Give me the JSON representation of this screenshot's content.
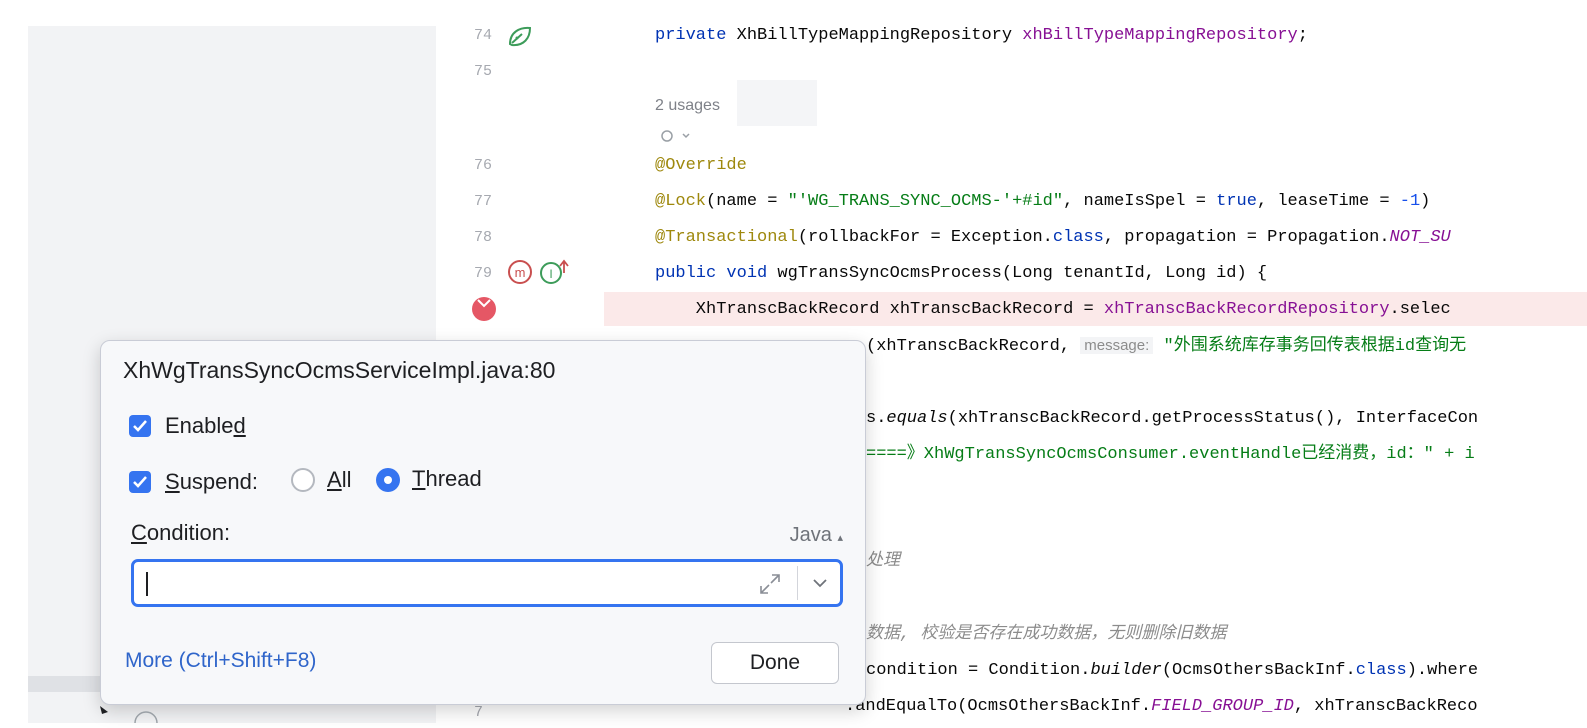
{
  "editor": {
    "usages_hint": "2 usages",
    "line_numbers": [
      "74",
      "75",
      "76",
      "77",
      "78",
      "79",
      "7"
    ],
    "lines": {
      "l74": {
        "kw": "private ",
        "type": "XhBillTypeMappingRepository ",
        "field": "xhBillTypeMappingRepository",
        "end": ";"
      },
      "l76": {
        "ann": "@Override"
      },
      "l77": {
        "ann": "@Lock",
        "a": "(name = ",
        "str": "\"'WG_TRANS_SYNC_OCMS-'+#id\"",
        "b": ", nameIsSpel = ",
        "kw": "true",
        "c": ", leaseTime = ",
        "num": "-1",
        "d": ")"
      },
      "l78": {
        "ann": "@Transactional",
        "a": "(rollbackFor = Exception.",
        "kw": "class",
        "b": ", propagation = Propagation.",
        "const": "NOT_SU"
      },
      "l79": {
        "kw": "public void ",
        "name": "wgTransSyncOcmsProcess",
        "a": "(Long tenantId, Long id) {"
      },
      "l80": {
        "a": "    XhTranscBackRecord xhTranscBackRecord = ",
        "field": "xhTranscBackRecordRepository",
        "b": ".selec"
      },
      "l81": {
        "a": "(xhTranscBackRecord, ",
        "hint": "message:",
        "str": "\"外围系统库存事务回传表根据id查询无"
      },
      "l82": {
        "a": "s.",
        "ital": "equals",
        "b": "(xhTranscBackRecord.getProcessStatus(), InterfaceCon"
      },
      "l83": {
        "str": "====》XhWgTransSyncOcmsConsumer.eventHandle已经消费，id：\" + i"
      },
      "l84": {
        "cmt": "处理"
      },
      "l85": {
        "cmt": "数据, 校验是否存在成功数据，无则删除旧数据"
      },
      "l86": {
        "a": "condition = Condition.",
        "ital": "builder",
        "b": "(OcmsOthersBackInf.",
        "kw": "class",
        "c": ").where"
      },
      "l87": {
        "a": ".andEqualTo(OcmsOthersBackInf.",
        "const": "FIELD_GROUP_ID",
        "b": ", xhTranscBackReco"
      }
    }
  },
  "popup": {
    "title": "XhWgTransSyncOcmsServiceImpl.java:80",
    "enabled": {
      "pre": "Enable",
      "mnemonic": "d",
      "checked": true
    },
    "suspend": {
      "mnemonic": "S",
      "rest": "uspend:",
      "checked": true
    },
    "radio_all": {
      "mnemonic": "A",
      "rest": "ll",
      "selected": false
    },
    "radio_thread": {
      "mnemonic": "T",
      "rest": "hread",
      "selected": true
    },
    "condition": {
      "mnemonic": "C",
      "rest": "ondition:",
      "value": ""
    },
    "language": "Java",
    "more_link": "More (Ctrl+Shift+F8)",
    "done_label": "Done"
  },
  "colors": {
    "accent": "#3574f0",
    "breakpoint": "#e55765",
    "keyword": "#0033b3",
    "field": "#871094",
    "annotation": "#9e880d",
    "string": "#067d17"
  }
}
